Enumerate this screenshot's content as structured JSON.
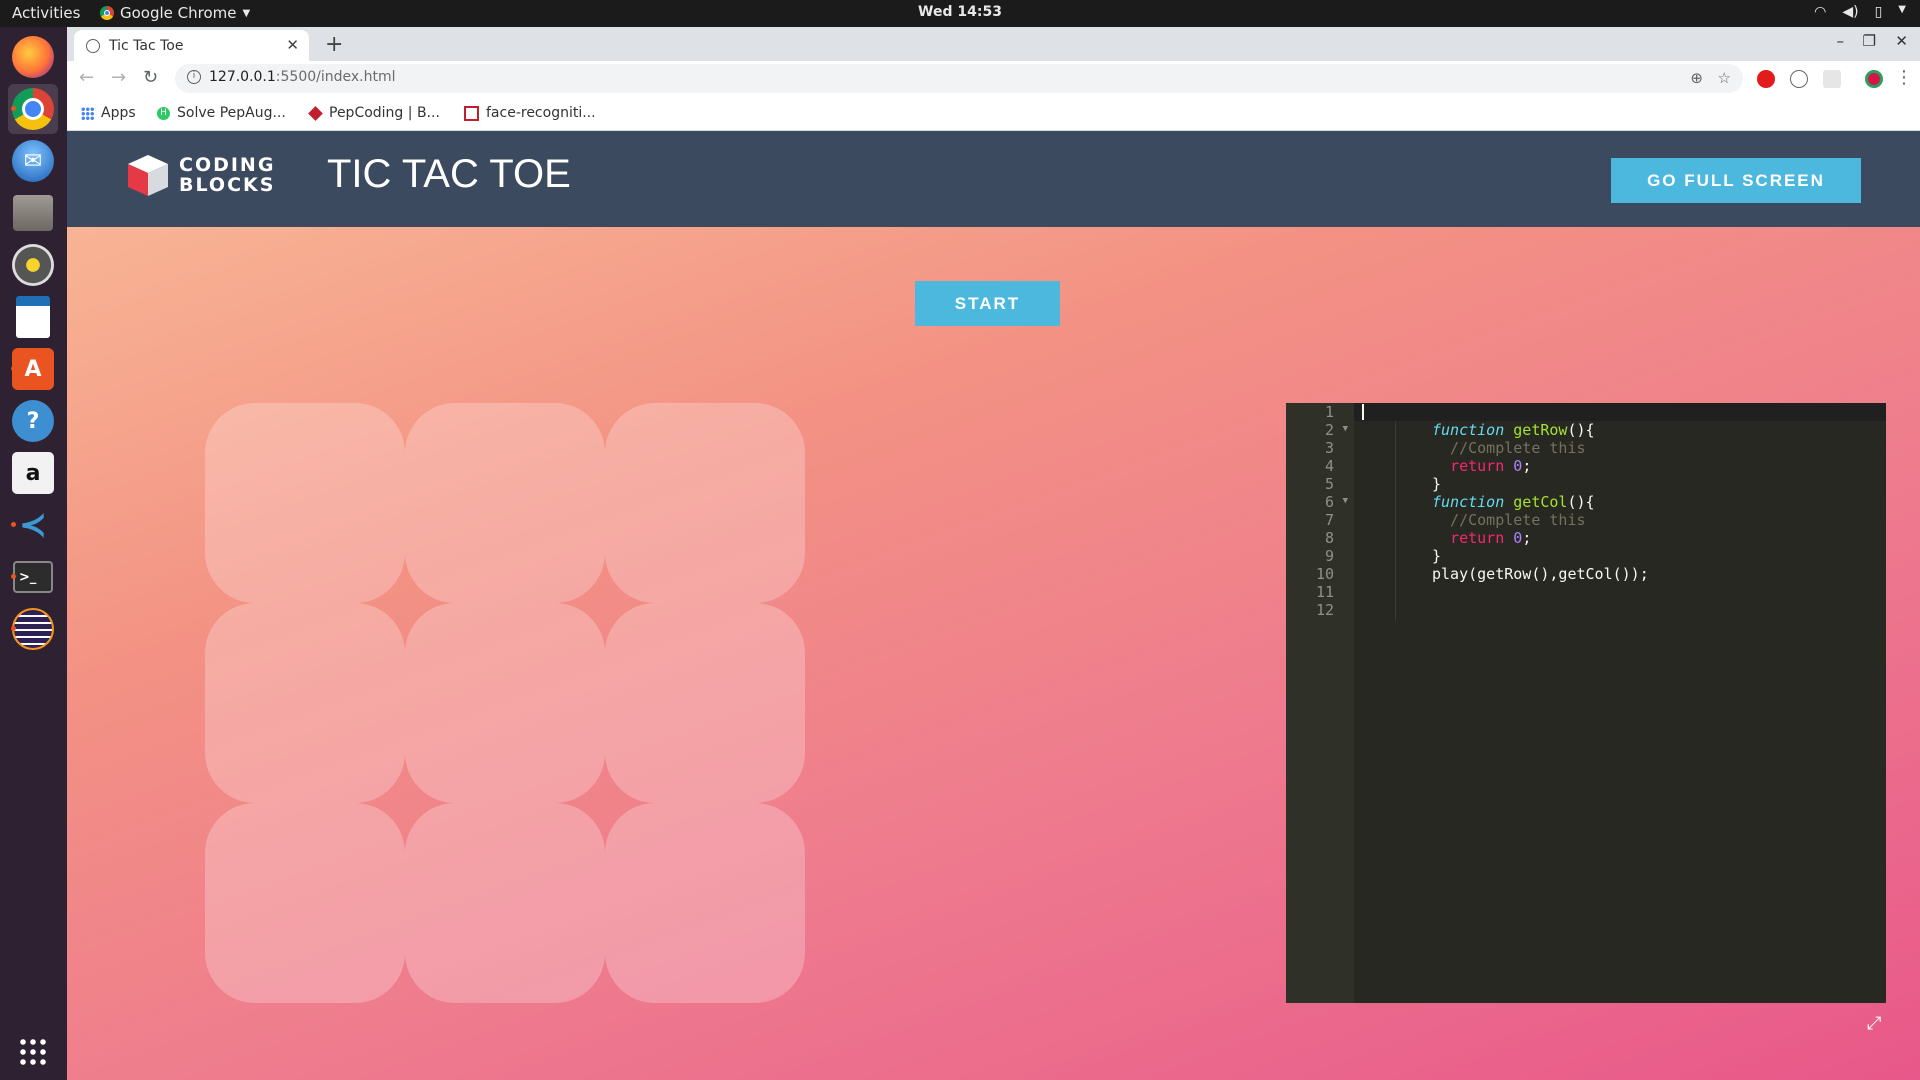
{
  "system": {
    "activities": "Activities",
    "app_name": "Google Chrome",
    "clock": "Wed 14:53"
  },
  "browser": {
    "tab_title": "Tic Tac Toe",
    "url_host": "127.0.0.1",
    "url_path": ":5500/index.html",
    "bookmarks": [
      "Apps",
      "Solve PepAug...",
      "PepCoding | B...",
      "face-recogniti..."
    ]
  },
  "page": {
    "logo_line1": "CODING",
    "logo_line2": "BLOCKS",
    "title": "TIC TAC TOE",
    "fullscreen_label": "GO FULL SCREEN",
    "start_label": "START"
  },
  "editor": {
    "line_numbers": [
      "1",
      "2",
      "3",
      "4",
      "5",
      "6",
      "7",
      "8",
      "9",
      "10",
      "11",
      "12"
    ],
    "code": [
      "",
      "function getRow(){",
      "  //Complete this",
      "  return 0;",
      "}",
      "function getCol(){",
      "  //Complete this",
      "  return 0;",
      "}",
      "play(getRow(),getCol());",
      "",
      ""
    ]
  },
  "colors": {
    "header_bg": "#3b4a5e",
    "button_blue": "#4cb8dd",
    "gradient_start": "#f8b494",
    "gradient_end": "#e8588a",
    "editor_bg": "#272822"
  }
}
